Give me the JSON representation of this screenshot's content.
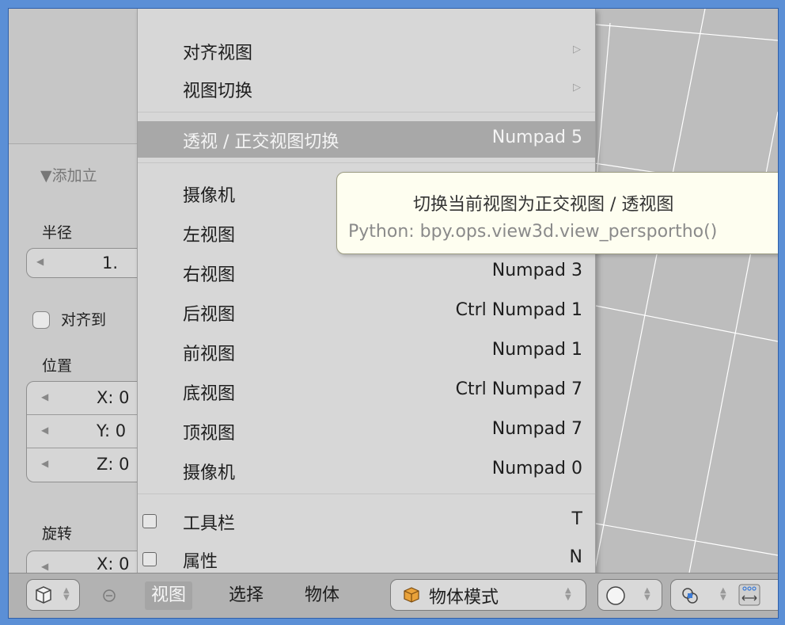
{
  "tool_panel": {
    "section_title": "▼添加立",
    "radius_label": "半径",
    "radius_value": "1.",
    "align_label": "对齐到",
    "location_label": "位置",
    "location_fields": [
      "X: 0",
      "Y: 0",
      "Z: 0"
    ],
    "rotation_label": "旋转",
    "rotation_first": "X: 0"
  },
  "view_menu": {
    "items": [
      {
        "label": "对齐视图",
        "shortcut": "",
        "submenu": true
      },
      {
        "label": "视图切换",
        "shortcut": "",
        "submenu": true
      },
      {
        "label": "透视 / 正交视图切换",
        "shortcut": "Numpad 5",
        "highlighted": true
      },
      {
        "label": "摄像机",
        "shortcut": ""
      },
      {
        "label": "左视图",
        "shortcut": ""
      },
      {
        "label": "右视图",
        "shortcut": "Numpad 3"
      },
      {
        "label": "后视图",
        "shortcut": "Ctrl Numpad 1"
      },
      {
        "label": "前视图",
        "shortcut": "Numpad 1"
      },
      {
        "label": "底视图",
        "shortcut": "Ctrl Numpad 7"
      },
      {
        "label": "顶视图",
        "shortcut": "Numpad 7"
      },
      {
        "label": "摄像机",
        "shortcut": "Numpad 0"
      },
      {
        "label": "工具栏",
        "shortcut": "T",
        "checkbox": true
      },
      {
        "label": "属性",
        "shortcut": "N",
        "checkbox": true
      }
    ]
  },
  "tooltip": {
    "description": "切换当前视图为正交视图 / 透视图",
    "python": "Python: bpy.ops.view3d.view_persportho()"
  },
  "header": {
    "menus": [
      "视图",
      "选择",
      "物体"
    ],
    "active_menu": "视图",
    "mode_label": "物体模式"
  },
  "colors": {
    "highlight": "#a8a8a8",
    "tooltip_bg": "#fefef0",
    "frame_border": "#5b8fd6"
  }
}
